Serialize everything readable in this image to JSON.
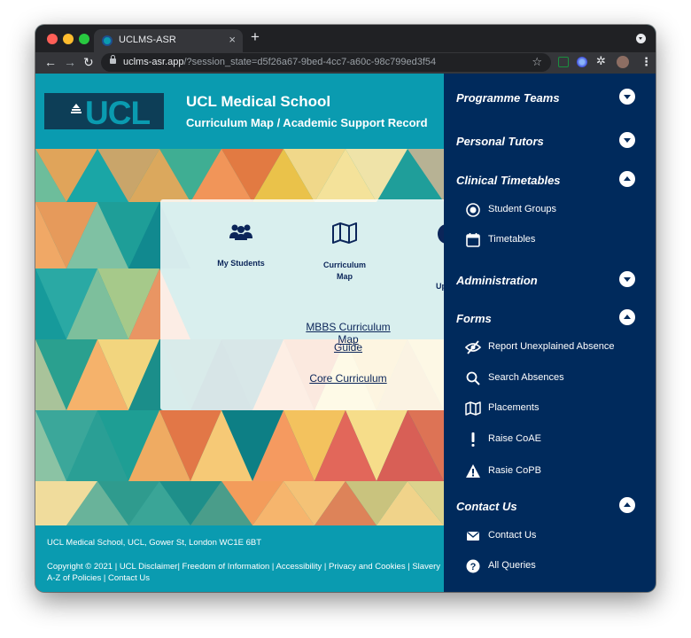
{
  "browser": {
    "tab_title": "UCLMS-ASR",
    "tab_close": "×",
    "new_tab": "+",
    "url_host": "uclms-asr.app",
    "url_path": "/?session_state=d5f26a67-9bed-4cc7-a60c-98c799ed3f54",
    "back": "←",
    "forward": "→",
    "reload": "↻",
    "bookmark": "☆",
    "extensions": "✲",
    "menu": "⋮"
  },
  "header": {
    "logo_text": "UCL",
    "school_name": "UCL Medical School",
    "subtitle": "Curriculum Map / Academic Support Record"
  },
  "card": {
    "tiles": [
      {
        "label_line1": "My Students",
        "label_line2": "",
        "icon": "users-icon"
      },
      {
        "label_line1": "Curriculum",
        "label_line2": "Map",
        "icon": "map-icon"
      }
    ],
    "cut_off_label": "Up",
    "link_guide_line1": "MBBS Curriculum Map",
    "link_guide_line2": "Guide",
    "link_core": "Core Curriculum"
  },
  "footer": {
    "address": "UCL Medical School, UCL, Gower St, London WC1E 6BT",
    "links_line1": "Copyright © 2021 | UCL Disclaimer| Freedom of Information | Accessibility | Privacy and Cookies | Slavery",
    "links_line2": "A-Z of Policies | Contact Us"
  },
  "sidebar": {
    "sections": [
      {
        "title": "Programme Teams",
        "expanded": false,
        "items": []
      },
      {
        "title": "Personal Tutors",
        "expanded": false,
        "items": []
      },
      {
        "title": "Clinical Timetables",
        "expanded": true,
        "items": [
          {
            "label": "Student Groups",
            "icon": "radio-target-icon"
          },
          {
            "label": "Timetables",
            "icon": "calendar-icon"
          }
        ]
      },
      {
        "title": "Administration",
        "expanded": false,
        "items": []
      },
      {
        "title": "Forms",
        "expanded": true,
        "items": [
          {
            "label": "Report Unexplained Absence",
            "icon": "eye-slash-icon"
          },
          {
            "label": "Search Absences",
            "icon": "search-icon"
          },
          {
            "label": "Placements",
            "icon": "map-icon"
          },
          {
            "label": "Raise CoAE",
            "icon": "exclamation-icon"
          },
          {
            "label": "Rasie CoPB",
            "icon": "warning-icon"
          }
        ]
      },
      {
        "title": "Contact Us",
        "expanded": true,
        "items": [
          {
            "label": "Contact Us",
            "icon": "envelope-icon"
          },
          {
            "label": "All Queries",
            "icon": "question-circle-icon"
          }
        ]
      }
    ]
  },
  "colors": {
    "teal": "#0a9bb0",
    "navy": "#002a5c",
    "card_text": "#0b2559"
  }
}
